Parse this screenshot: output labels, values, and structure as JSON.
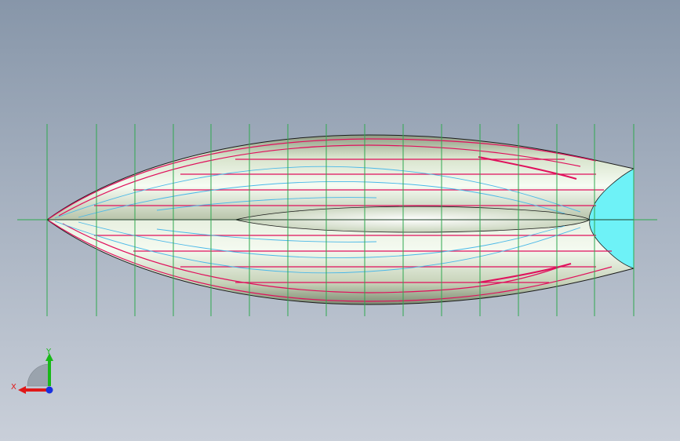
{
  "view": {
    "background_top": "#8796a9",
    "background_bottom": "#c9cfd9"
  },
  "colors": {
    "hull_light": "#f4fbf2",
    "hull_mid": "#d4dfc7",
    "hull_dark": "#8e9a82",
    "station_line": "#2fa84f",
    "waterline": "#e0105c",
    "buttock": "#4ab8e8",
    "transom": "#6ef2f7",
    "outline": "#1a1a1a"
  },
  "triad": {
    "x_label": "X",
    "y_label": "Y",
    "x_color": "#e01818",
    "y_color": "#18b818",
    "z_color": "#1830e0"
  }
}
